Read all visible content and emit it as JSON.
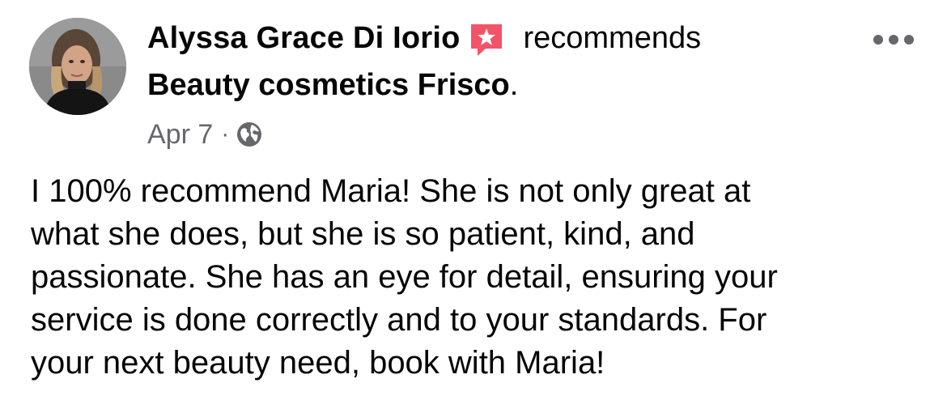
{
  "post": {
    "author_name": "Alyssa Grace Di Iorio",
    "action": "recommends",
    "page_name": "Beauty cosmetics Frisco",
    "page_suffix": ".",
    "date": "Apr 7",
    "separator": "·",
    "audience_icon": "globe-icon",
    "badge_icon": "recommendation-star-icon",
    "menu_icon": "more-options-icon",
    "body": "I 100% recommend Maria! She is not only great at\nwhat she does, but she is so patient, kind, and\npassionate. She has an eye for detail, ensuring your\nservice is done correctly and to your standards. For\nyour next beauty need, book with Maria!"
  },
  "colors": {
    "text_primary": "#050505",
    "text_secondary": "#65676b",
    "badge_red": "#f35369",
    "background": "#ffffff"
  }
}
